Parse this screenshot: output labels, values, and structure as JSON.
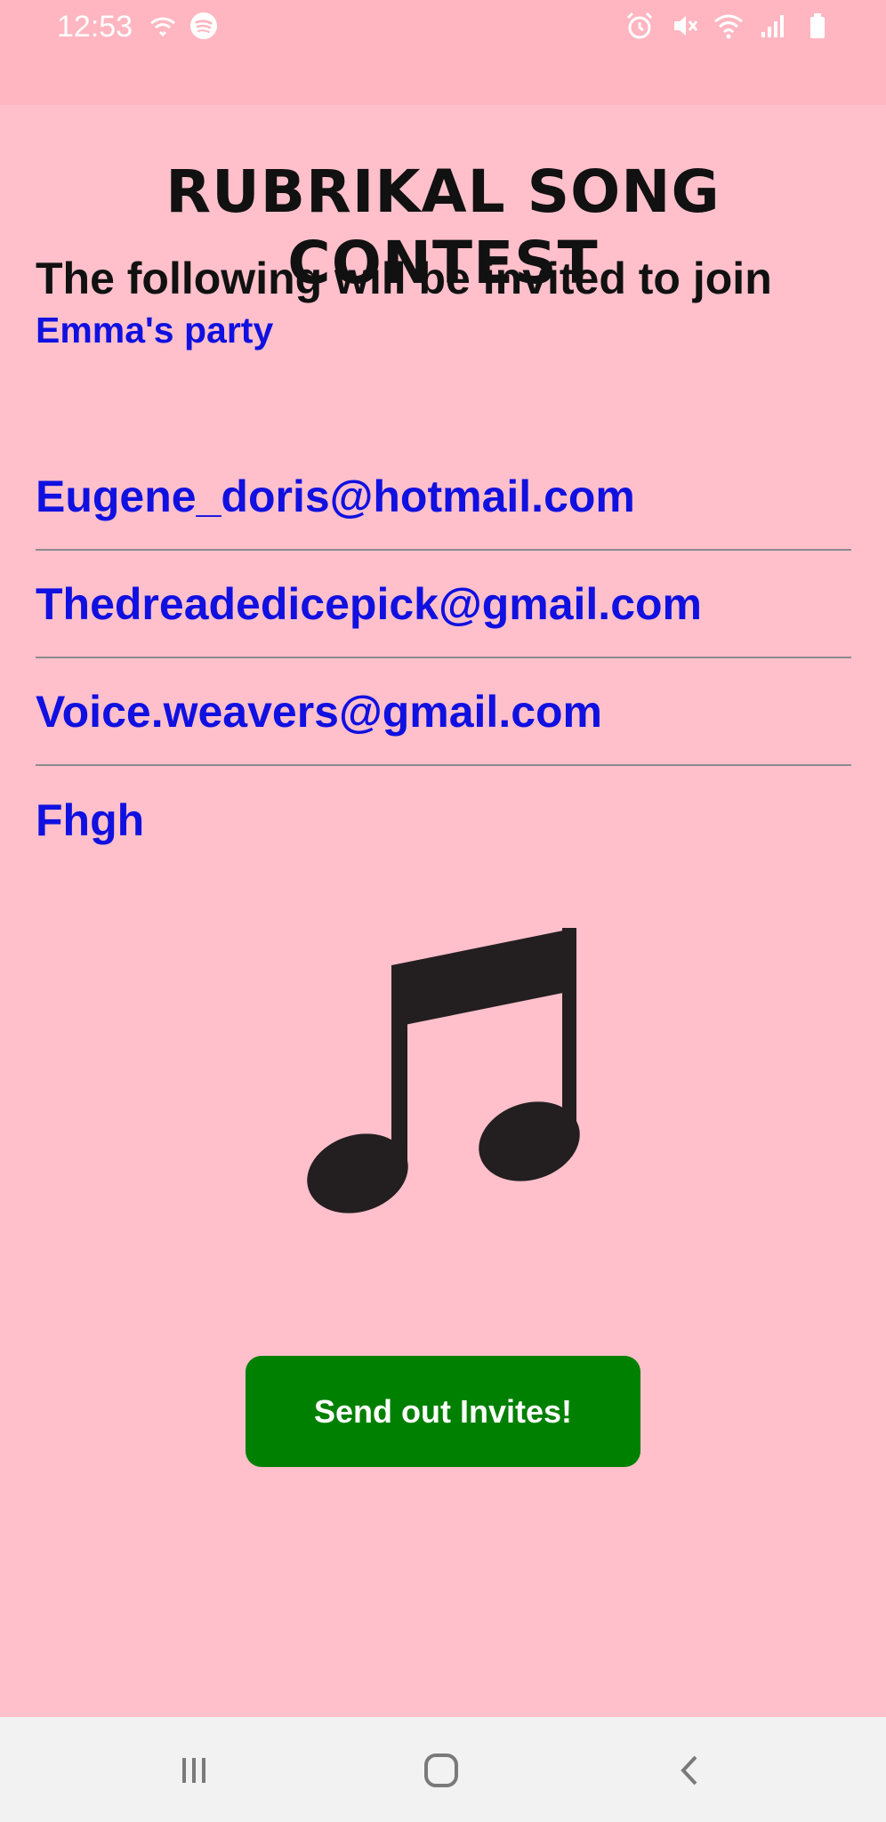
{
  "status_bar": {
    "time": "12:53",
    "left_icons": [
      "wifi-calling-icon",
      "spotify-icon"
    ],
    "right_icons": [
      "alarm-icon",
      "vibrate-mute-icon",
      "wifi-icon",
      "signal-icon",
      "battery-icon"
    ]
  },
  "app": {
    "title": "RUBRIKAL SONG CONTEST",
    "heading": "The following will be invited to join",
    "party_name": "Emma's party"
  },
  "invites": [
    "Eugene_doris@hotmail.com",
    "Thedreadedicepick@gmail.com",
    "Voice.weavers@gmail.com",
    "Fhgh"
  ],
  "illustration": {
    "icon": "music-note-icon",
    "color": "#231f20"
  },
  "send_button": {
    "label": "Send out Invites!",
    "color": "#008000"
  },
  "nav_bar": {
    "buttons": [
      "recent-apps-icon",
      "home-icon",
      "back-icon"
    ]
  },
  "colors": {
    "background": "#ffc0cb",
    "status_bar": "#ffb6c1",
    "accent_text": "#1010e0"
  }
}
